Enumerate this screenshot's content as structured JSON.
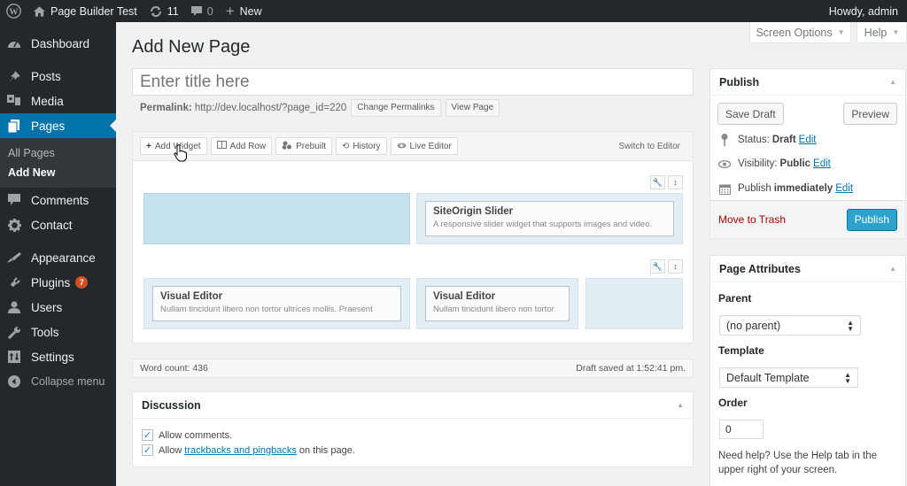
{
  "adminbar": {
    "wp_logo": "wordpress-logo",
    "site_name": "Page Builder Test",
    "updates_count": "11",
    "comments_count": "0",
    "new_label": "New",
    "greeting": "Howdy, admin"
  },
  "sidebar": {
    "items": [
      {
        "label": "Dashboard",
        "icon": "dashboard-icon"
      },
      {
        "label": "Posts",
        "icon": "pin-icon"
      },
      {
        "label": "Media",
        "icon": "media-icon"
      },
      {
        "label": "Pages",
        "icon": "pages-icon",
        "current": true
      },
      {
        "label": "Comments",
        "icon": "comment-icon"
      },
      {
        "label": "Contact",
        "icon": "gear-icon"
      },
      {
        "label": "Appearance",
        "icon": "brush-icon"
      },
      {
        "label": "Plugins",
        "icon": "plugin-icon",
        "badge": "7"
      },
      {
        "label": "Users",
        "icon": "user-icon"
      },
      {
        "label": "Tools",
        "icon": "wrench-icon"
      },
      {
        "label": "Settings",
        "icon": "settings-icon"
      }
    ],
    "submenu": [
      "All Pages",
      "Add New"
    ],
    "collapse_label": "Collapse menu"
  },
  "screen_meta": {
    "screen_options": "Screen Options",
    "help": "Help"
  },
  "main": {
    "page_title": "Add New Page",
    "title_placeholder": "Enter title here",
    "permalink_label": "Permalink:",
    "permalink_url": "http://dev.localhost/?page_id=220",
    "change_permalinks": "Change Permalinks",
    "view_page": "View Page"
  },
  "builder": {
    "toolbar": [
      {
        "label": "Add Widget",
        "icon": "plus-icon"
      },
      {
        "label": "Add Row",
        "icon": "columns-icon"
      },
      {
        "label": "Prebuilt",
        "icon": "prebuilt-icon"
      },
      {
        "label": "History",
        "icon": "history-icon"
      },
      {
        "label": "Live Editor",
        "icon": "eye-icon"
      }
    ],
    "switch_label": "Switch to Editor",
    "rows": [
      {
        "widgets": [
          {
            "title": "SiteOrigin Slider",
            "desc": "A responsive slider widget that supports images and video."
          }
        ]
      },
      {
        "widgets": [
          {
            "title": "Visual Editor",
            "desc": "Nullam tincidunt libero non tortor ultrices mollis. Praesent"
          },
          {
            "title": "Visual Editor",
            "desc": "Nullam tincidunt libero non tortor"
          }
        ]
      }
    ]
  },
  "statusbar": {
    "word_count": "Word count: 436",
    "draft_saved": "Draft saved at 1:52:41 pm."
  },
  "discussion": {
    "title": "Discussion",
    "allow_comments": "Allow comments.",
    "allow_prefix": "Allow",
    "trackbacks_link": "trackbacks and pingbacks",
    "allow_suffix": "on this page.",
    "comments_checked": true,
    "trackbacks_checked": true
  },
  "publish": {
    "title": "Publish",
    "save_draft": "Save Draft",
    "preview": "Preview",
    "status_label": "Status:",
    "status_value": "Draft",
    "visibility_label": "Visibility:",
    "visibility_value": "Public",
    "publish_label": "Publish",
    "publish_value": "immediately",
    "edit": "Edit",
    "move_to_trash": "Move to Trash",
    "publish_button": "Publish",
    "accent_color": "#2ea2cc"
  },
  "attributes": {
    "title": "Page Attributes",
    "parent_label": "Parent",
    "parent_value": "(no parent)",
    "template_label": "Template",
    "template_value": "Default Template",
    "order_label": "Order",
    "order_value": "0",
    "help_text": "Need help? Use the Help tab in the upper right of your screen."
  }
}
